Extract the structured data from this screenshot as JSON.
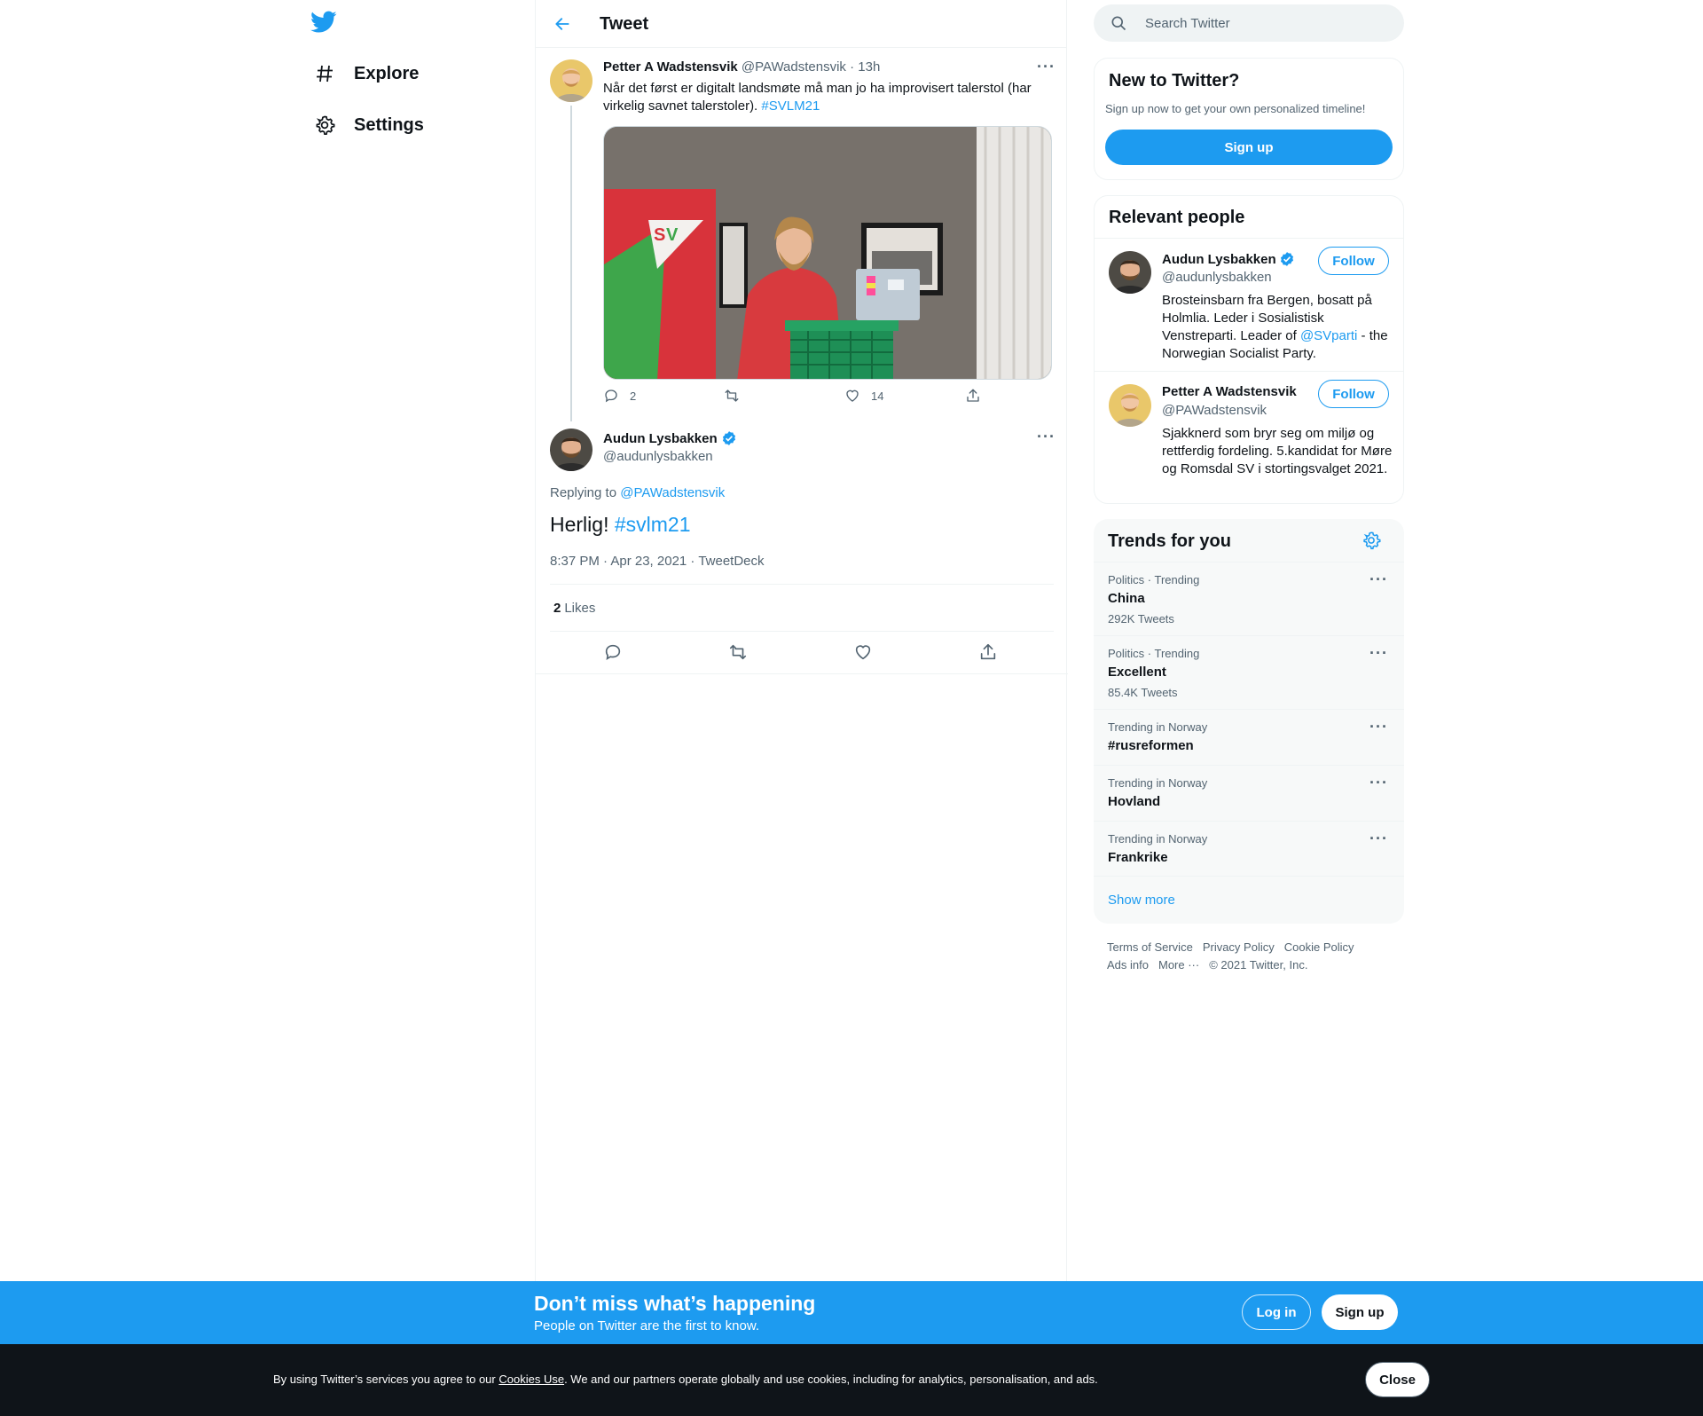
{
  "nav": {
    "logo_icon": "twitter-bird-icon",
    "items": [
      {
        "label": "Explore",
        "icon": "hashtag-icon"
      },
      {
        "label": "Settings",
        "icon": "gear-icon"
      }
    ]
  },
  "header": {
    "title": "Tweet",
    "back_icon": "arrow-left-icon"
  },
  "parent_tweet": {
    "name": "Petter A Wadstensvik",
    "handle": "@PAWadstensvik",
    "sep": " · ",
    "time": "13h",
    "text": "Når det først er digitalt landsmøte må man jo ha improvisert talerstol (har virkelig savnet talerstoler). ",
    "hashtag": "#SVLM21",
    "replies": "2",
    "likes": "14"
  },
  "main_tweet": {
    "name": "Audun Lysbakken",
    "handle": "@audunlysbakken",
    "replying_prefix": "Replying to ",
    "replying_to": "@PAWadstensvik",
    "text": "Herlig! ",
    "hashtag": "#svlm21",
    "timestamp": "8:37 PM · Apr 23, 2021 · TweetDeck",
    "likes_count": "2",
    "likes_label": "Likes"
  },
  "search": {
    "placeholder": "Search Twitter"
  },
  "new_to_twitter": {
    "title": "New to Twitter?",
    "subtitle": "Sign up now to get your own personalized timeline!",
    "button": "Sign up"
  },
  "relevant_people": {
    "title": "Relevant people",
    "follow_label": "Follow",
    "people": [
      {
        "name": "Audun Lysbakken",
        "handle": "@audunlysbakken",
        "bio_pre": "Brosteinsbarn fra Bergen, bosatt på Holmlia. Leder i Sosialistisk Venstreparti. Leader of ",
        "bio_link": "@SVparti",
        "bio_post": " - the Norwegian Socialist Party."
      },
      {
        "name": "Petter A Wadstensvik",
        "handle": "@PAWadstensvik",
        "bio": "Sjakknerd som bryr seg om miljø og rettferdig fordeling. 5.kandidat for Møre og Romsdal SV i stortingsvalget 2021."
      }
    ]
  },
  "trends": {
    "title": "Trends for you",
    "items": [
      {
        "context": "Politics · Trending",
        "name": "China",
        "count": "292K Tweets"
      },
      {
        "context": "Politics · Trending",
        "name": "Excellent",
        "count": "85.4K Tweets"
      },
      {
        "context": "Trending in Norway",
        "name": "#rusreformen",
        "count": ""
      },
      {
        "context": "Trending in Norway",
        "name": "Hovland",
        "count": ""
      },
      {
        "context": "Trending in Norway",
        "name": "Frankrike",
        "count": ""
      }
    ],
    "show_more": "Show more"
  },
  "footer": {
    "terms": "Terms of Service",
    "privacy": "Privacy Policy",
    "cookie": "Cookie Policy",
    "ads": "Ads info",
    "more": "More ···",
    "copyright": "© 2021 Twitter, Inc."
  },
  "banner": {
    "title": "Don’t miss what’s happening",
    "subtitle": "People on Twitter are the first to know.",
    "login": "Log in",
    "signup": "Sign up"
  },
  "cookie": {
    "pre": "By using Twitter’s services you agree to our ",
    "link": "Cookies Use",
    "post": ". We and our partners operate globally and use cookies, including for analytics, personalisation, and ads.",
    "close": "Close"
  },
  "colors": {
    "accent": "#1d9bf0",
    "text": "#0f1419",
    "muted": "#536471",
    "cookie_bg": "#0f1419"
  }
}
